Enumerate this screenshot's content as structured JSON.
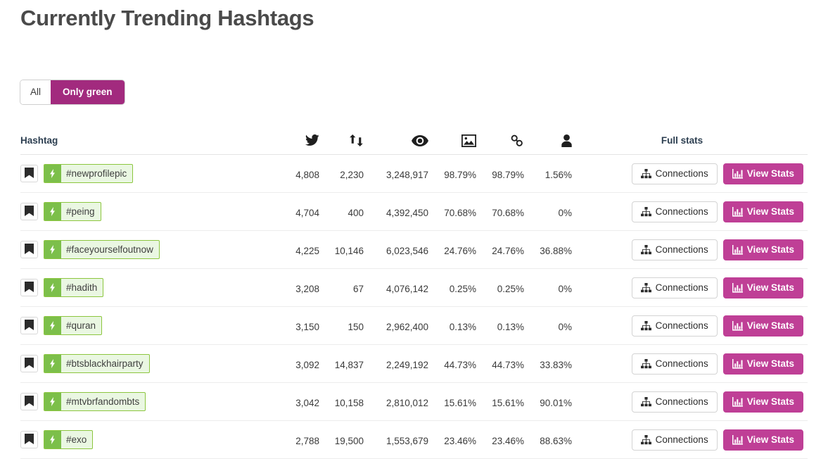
{
  "page": {
    "title": "Currently Trending Hashtags"
  },
  "filters": {
    "all_label": "All",
    "only_green_label": "Only green",
    "active": "Only green",
    "active_color": "#a22a7e"
  },
  "table": {
    "headers": {
      "hashtag": "Hashtag",
      "tweets_icon": "twitter-icon",
      "retweets_icon": "retweet-icon",
      "views_icon": "eye-icon",
      "images_icon": "image-icon",
      "links_icon": "link-icon",
      "users_icon": "user-icon",
      "full_stats": "Full stats"
    },
    "row_buttons": {
      "connections_label": "Connections",
      "connections_icon": "sitemap-icon",
      "view_stats_label": "View Stats",
      "view_stats_icon": "bar-chart-icon",
      "bookmark_icon": "bookmark-icon",
      "bolt_icon": "lightning-bolt-icon"
    },
    "rows": [
      {
        "hashtag": "#newprofilepic",
        "tweets": "4,808",
        "retweets": "2,230",
        "views": "3,248,917",
        "images": "98.79%",
        "links": "98.79%",
        "users": "1.56%"
      },
      {
        "hashtag": "#peing",
        "tweets": "4,704",
        "retweets": "400",
        "views": "4,392,450",
        "images": "70.68%",
        "links": "70.68%",
        "users": "0%"
      },
      {
        "hashtag": "#faceyourselfoutnow",
        "tweets": "4,225",
        "retweets": "10,146",
        "views": "6,023,546",
        "images": "24.76%",
        "links": "24.76%",
        "users": "36.88%"
      },
      {
        "hashtag": "#hadith",
        "tweets": "3,208",
        "retweets": "67",
        "views": "4,076,142",
        "images": "0.25%",
        "links": "0.25%",
        "users": "0%"
      },
      {
        "hashtag": "#quran",
        "tweets": "3,150",
        "retweets": "150",
        "views": "2,962,400",
        "images": "0.13%",
        "links": "0.13%",
        "users": "0%"
      },
      {
        "hashtag": "#btsblackhairparty",
        "tweets": "3,092",
        "retweets": "14,837",
        "views": "2,249,192",
        "images": "44.73%",
        "links": "44.73%",
        "users": "33.83%"
      },
      {
        "hashtag": "#mtvbrfandombts",
        "tweets": "3,042",
        "retweets": "10,158",
        "views": "2,810,012",
        "images": "15.61%",
        "links": "15.61%",
        "users": "90.01%"
      },
      {
        "hashtag": "#exo",
        "tweets": "2,788",
        "retweets": "19,500",
        "views": "1,553,679",
        "images": "23.46%",
        "links": "23.46%",
        "users": "88.63%"
      }
    ]
  },
  "colors": {
    "accent_magenta": "#bf3f96",
    "filter_active": "#a22a7e",
    "green_badge": "#7cbf4a",
    "green_bg": "#eaf7e2"
  }
}
